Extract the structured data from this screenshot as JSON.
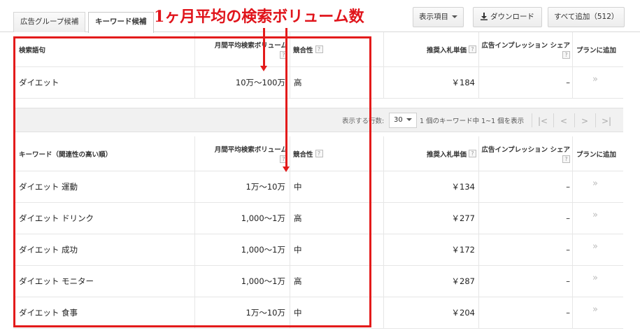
{
  "tabs": [
    {
      "label": "広告グループ候補"
    },
    {
      "label": "キーワード候補"
    }
  ],
  "toolbar": {
    "columns_label": "表示項目",
    "download_label": "ダウンロード",
    "add_all_label": "すべて追加（512）"
  },
  "annotation": {
    "title": "1ヶ月平均の検索ボリューム数"
  },
  "headers": {
    "search_term": "検索語句",
    "keyword": "キーワード（関連性の高い順）",
    "volume": "月間平均検索ボリューム",
    "competition": "競合性",
    "bid": "推奨入札単価",
    "impression_share": "広告インプレッション シェア",
    "add_to_plan": "プランに追加",
    "help": "?"
  },
  "search_rows": [
    {
      "keyword": "ダイエット",
      "volume": "10万～100万",
      "competition": "高",
      "bid": "￥184",
      "share": "–"
    }
  ],
  "pager": {
    "rows_label": "表示する行数:",
    "rows_value": "30",
    "summary": "1 個のキーワード中 1~1 個を表示"
  },
  "keyword_rows": [
    {
      "keyword": "ダイエット 運動",
      "volume": "1万～10万",
      "competition": "中",
      "bid": "￥134",
      "share": "–"
    },
    {
      "keyword": "ダイエット ドリンク",
      "volume": "1,000～1万",
      "competition": "高",
      "bid": "￥277",
      "share": "–"
    },
    {
      "keyword": "ダイエット 成功",
      "volume": "1,000～1万",
      "competition": "中",
      "bid": "￥172",
      "share": "–"
    },
    {
      "keyword": "ダイエット モニター",
      "volume": "1,000～1万",
      "competition": "高",
      "bid": "￥287",
      "share": "–"
    },
    {
      "keyword": "ダイエット 食事",
      "volume": "1万～10万",
      "competition": "中",
      "bid": "￥204",
      "share": "–"
    }
  ],
  "icons": {
    "add": "double-chevron-right-icon",
    "download": "download-icon",
    "help": "help-icon"
  },
  "colors": {
    "annotation_red": "#e31b1b"
  }
}
